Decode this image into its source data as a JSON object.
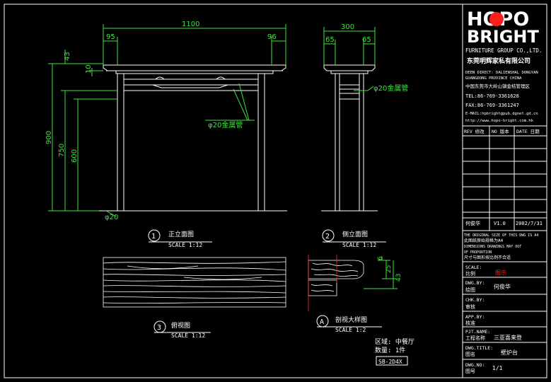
{
  "logo": {
    "word1": "HOPO",
    "word2": "BRIGHT",
    "sub": "FURNITURE GROUP CO.,LTD.",
    "cn_name": "东莞明辉家私有限公司"
  },
  "company_info": [
    "DEEN DIRECT: DALIENSHAL DONGYAN",
    "GUANGDONG PROVINCE CHINA",
    "中国东莞市大岭山镇金桔管理区",
    "TEL:86-769-3361628",
    "FAX:86-769-3361247",
    "E-MAIL:hpbright@pub.dgnet.gd.cn",
    "http://www.hopo-bright.com.hk"
  ],
  "rev_headers": [
    "REV 修改",
    "NO 版本",
    "DATE 日期"
  ],
  "rev_row": {
    "name": "何俊华",
    "ver": "V1.0",
    "date": "2002/7/31"
  },
  "notes": [
    "THE ORIGINAL SIZE OF THIS DWG IS A4",
    "此图纸原始规格为A4",
    "DIMENSIONS DRAWINGS MAY OUT",
    "OF PROPORTION",
    "尺寸与图形按比例不合适"
  ],
  "title_rows": [
    {
      "en": "SCALE:",
      "cn": "比例",
      "value": "图示",
      "value_color": "#ff2a2a"
    },
    {
      "en": "DWG.BY:",
      "cn": "绘图",
      "value": "何俊华",
      "value_color": "#ffffff"
    },
    {
      "en": "CHK.BY:",
      "cn": "审核",
      "value": "",
      "value_color": "#ffffff"
    },
    {
      "en": "APP.BY:",
      "cn": "核准",
      "value": "",
      "value_color": "#ffffff"
    },
    {
      "en": "PJT.NAME:",
      "cn": "工程名称",
      "value": "三亚喜来登",
      "value_color": "#ffffff"
    },
    {
      "en": "DWG.TITLE:",
      "cn": "图名",
      "value": "壁炉台",
      "value_color": "#ffffff"
    },
    {
      "en": "DWG.NO:",
      "cn": "图号",
      "value": "1/1",
      "value_color": "#ffffff"
    }
  ],
  "dims": {
    "front_w": "1100",
    "front_l": "95",
    "front_r": "96",
    "h_top": "43",
    "h_10": "10",
    "h_900": "900",
    "h_750": "750",
    "h_600": "600",
    "leg": "φ20",
    "pipe_front": "φ20金属管",
    "side_w": "300",
    "side_l": "65",
    "side_r": "65",
    "pipe_side": "φ20金属管",
    "d6": "6",
    "d25": "25",
    "d43": "43"
  },
  "views": [
    {
      "num": "1",
      "cn": "正立面图",
      "scale": "SCALE 1:12"
    },
    {
      "num": "2",
      "cn": "侧立面图",
      "scale": "SCALE 1:12"
    },
    {
      "num": "3",
      "cn": "俯视图",
      "scale": "SCALE 1:12"
    },
    {
      "num": "A",
      "cn": "剖视大样图",
      "scale": "SCALE 1:2"
    }
  ],
  "info": {
    "area": "区域: 中餐厅",
    "qty": "数量: 1件",
    "code": "SB-2D4X"
  }
}
